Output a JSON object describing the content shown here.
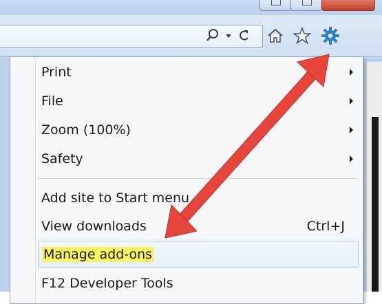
{
  "menu": {
    "items": [
      {
        "label": "Print",
        "shortcut": "",
        "submenu": true
      },
      {
        "label": "File",
        "shortcut": "",
        "submenu": true
      },
      {
        "label": "Zoom (100%)",
        "shortcut": "",
        "submenu": true
      },
      {
        "label": "Safety",
        "shortcut": "",
        "submenu": true
      },
      {
        "label": "Add site to Start menu",
        "shortcut": "",
        "submenu": false
      },
      {
        "label": "View downloads",
        "shortcut": "Ctrl+J",
        "submenu": false
      },
      {
        "label": "Manage add-ons",
        "shortcut": "",
        "submenu": false
      },
      {
        "label": "F12 Developer Tools",
        "shortcut": "",
        "submenu": false
      }
    ]
  },
  "toolbar": {
    "icons": [
      "search-icon",
      "dropdown-icon",
      "refresh-icon",
      "home-icon",
      "favorites-star-icon",
      "tools-gear-icon"
    ]
  },
  "colors": {
    "highlight": "#f7f25e",
    "annotation_arrow": "#e8463c",
    "gear": "#2f7fc1"
  }
}
